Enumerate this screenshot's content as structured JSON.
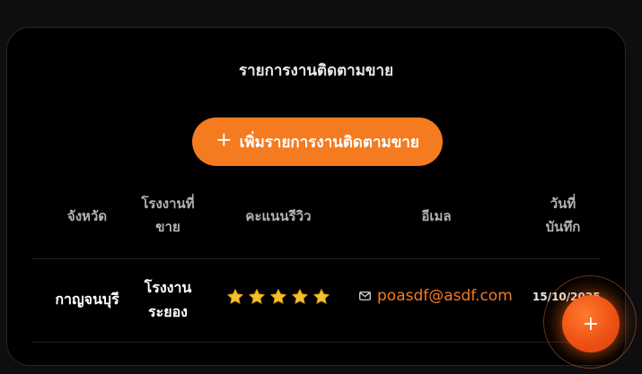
{
  "card": {
    "title": "รายการงานติดตามขาย",
    "add_button_label": "เพิ่มรายการงานติดตามขาย"
  },
  "table": {
    "columns": {
      "province": "จังหวัด",
      "factory_line1": "โรงงานที่",
      "factory_line2": "ขาย",
      "rating": "คะแนนรีวิว",
      "email": "อีเมล",
      "date_line1": "วันที่",
      "date_line2": "บันทึก"
    },
    "rows": [
      {
        "province": "กาญจนบุรี",
        "factory_line1": "โรงงาน",
        "factory_line2": "ระยอง",
        "rating": 5,
        "email": "poasdf@asdf.com",
        "date": "15/10/2025"
      }
    ]
  },
  "fab": {
    "label": "+"
  },
  "colors": {
    "accent": "#f47b20",
    "fab": "#ec4f12",
    "star": "#f2c12e",
    "background": "#000000"
  },
  "icons": {
    "add_button": "plus-icon",
    "email": "mail-icon",
    "rating": "star-icon"
  }
}
